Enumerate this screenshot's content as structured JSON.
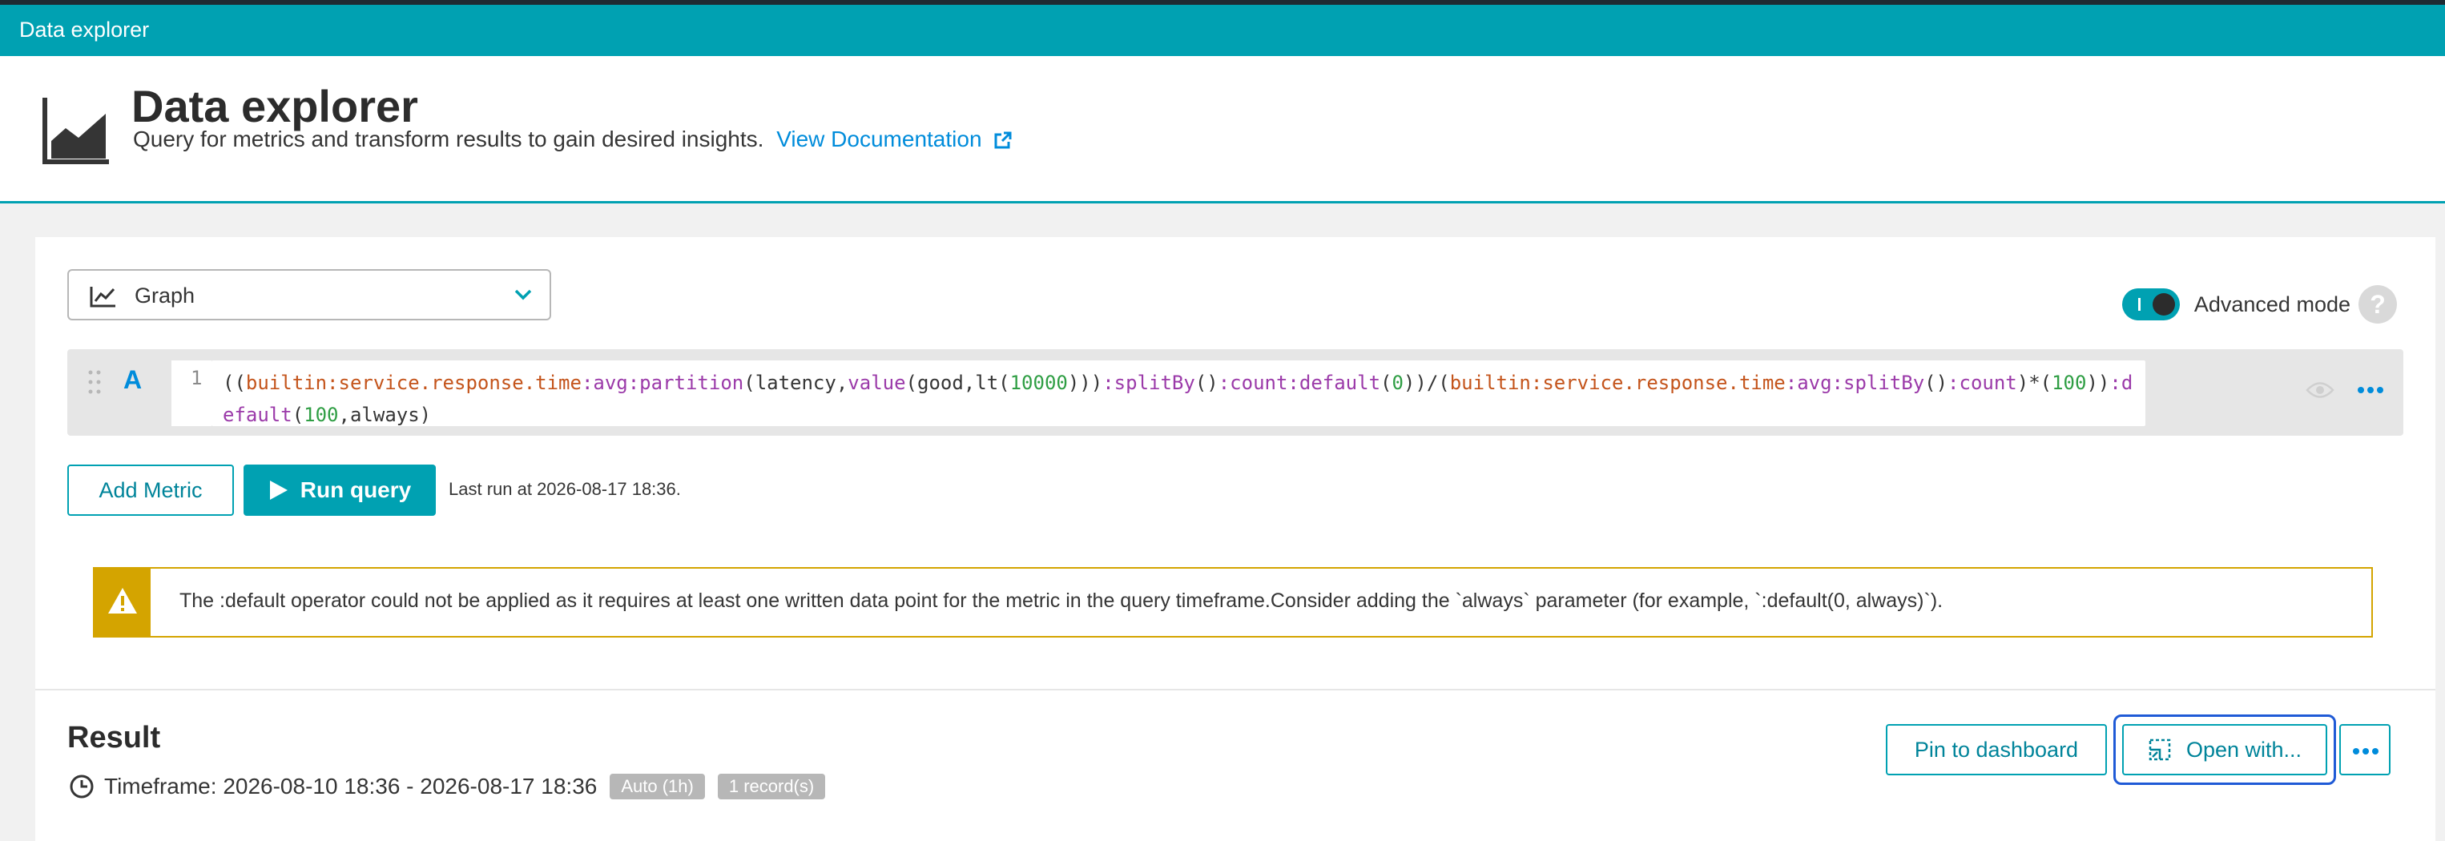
{
  "topbar": {
    "title": "Data explorer"
  },
  "header": {
    "title": "Data explorer",
    "subtitle": "Query for metrics and transform results to gain desired insights.",
    "doc_link": "View Documentation"
  },
  "visualization": {
    "selected": "Graph"
  },
  "advanced_mode": {
    "label": "Advanced mode",
    "enabled": true
  },
  "query": {
    "letter": "A",
    "line_number": "1",
    "code": "((builtin:service.response.time:avg:partition(latency,value(good,lt(10000))):splitBy():count:default(0))/(builtin:service.response.time:avg:splitBy():count)*(100)):default(100,always)"
  },
  "actions": {
    "add_metric": "Add Metric",
    "run_query": "Run query",
    "last_run": "Last run at 2026-08-17 18:36."
  },
  "warning": {
    "message": "The :default operator could not be applied as it requires at least one written data point for the metric in the query timeframe.Consider adding the `always` parameter (for example, `:default(0, always)`)."
  },
  "result": {
    "title": "Result",
    "timeframe": "Timeframe: 2026-08-10 18:36 - 2026-08-17 18:36",
    "resolution_badge": "Auto (1h)",
    "records_badge": "1 record(s)",
    "pin_button": "Pin to dashboard",
    "open_button": "Open with..."
  },
  "colors": {
    "accent": "#00a1b2",
    "link": "#008cdb",
    "warning": "#d4a400",
    "focus": "#1f5ad6"
  }
}
